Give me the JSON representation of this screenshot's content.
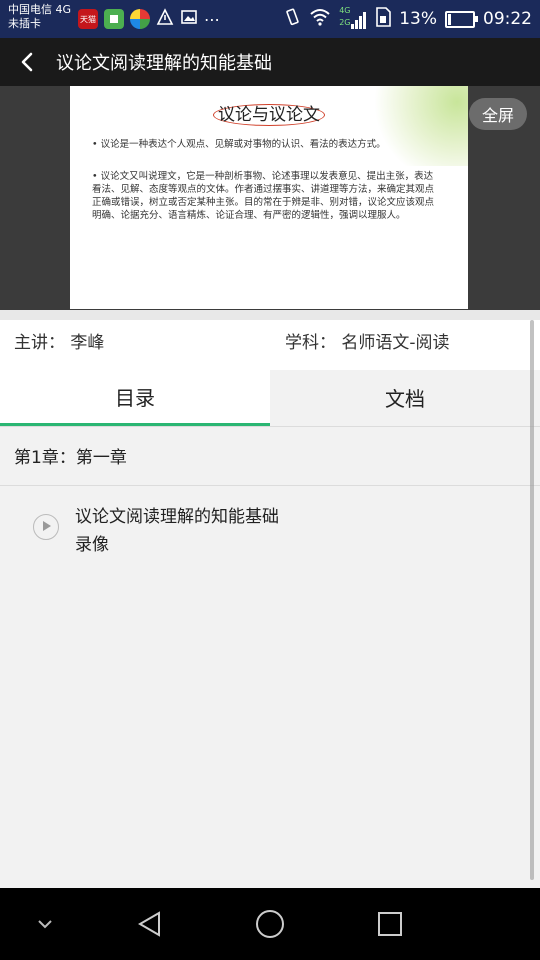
{
  "status_bar": {
    "carrier_line1": "中国电信 4G",
    "carrier_line2": "未插卡",
    "app_badge_tmall": "天猫",
    "signal_4g": "4G",
    "signal_2g": "2G",
    "battery": "13%",
    "time": "09:22"
  },
  "header": {
    "title": "议论文阅读理解的知能基础"
  },
  "video": {
    "fullscreen_label": "全屏",
    "slide": {
      "title": "议论与议论文",
      "para1": "议论是一种表达个人观点、见解或对事物的认识、看法的表达方式。",
      "para2": "议论文又叫说理文，它是一种剖析事物、论述事理以发表意见、提出主张，表达看法、见解、态度等观点的文体。作者通过摆事实、讲道理等方法，来确定其观点正确或错误，树立或否定某种主张。目的常在于辨是非、别对错，议论文应该观点明确、论据充分、语言精炼、论证合理、有严密的逻辑性，强调以理服人。"
    }
  },
  "course_info": {
    "lecturer_label": "主讲：",
    "lecturer": "李峰",
    "subject_label": "学科：",
    "subject": "名师语文-阅读"
  },
  "tabs": [
    {
      "label": "目录"
    },
    {
      "label": "文档"
    }
  ],
  "chapter": {
    "label": "第1章：第一章"
  },
  "lessons": [
    {
      "title": "议论文阅读理解的知能基础",
      "type": "录像"
    }
  ],
  "colors": {
    "status_bar": "#1b2a5a",
    "accent": "#2bb673"
  }
}
